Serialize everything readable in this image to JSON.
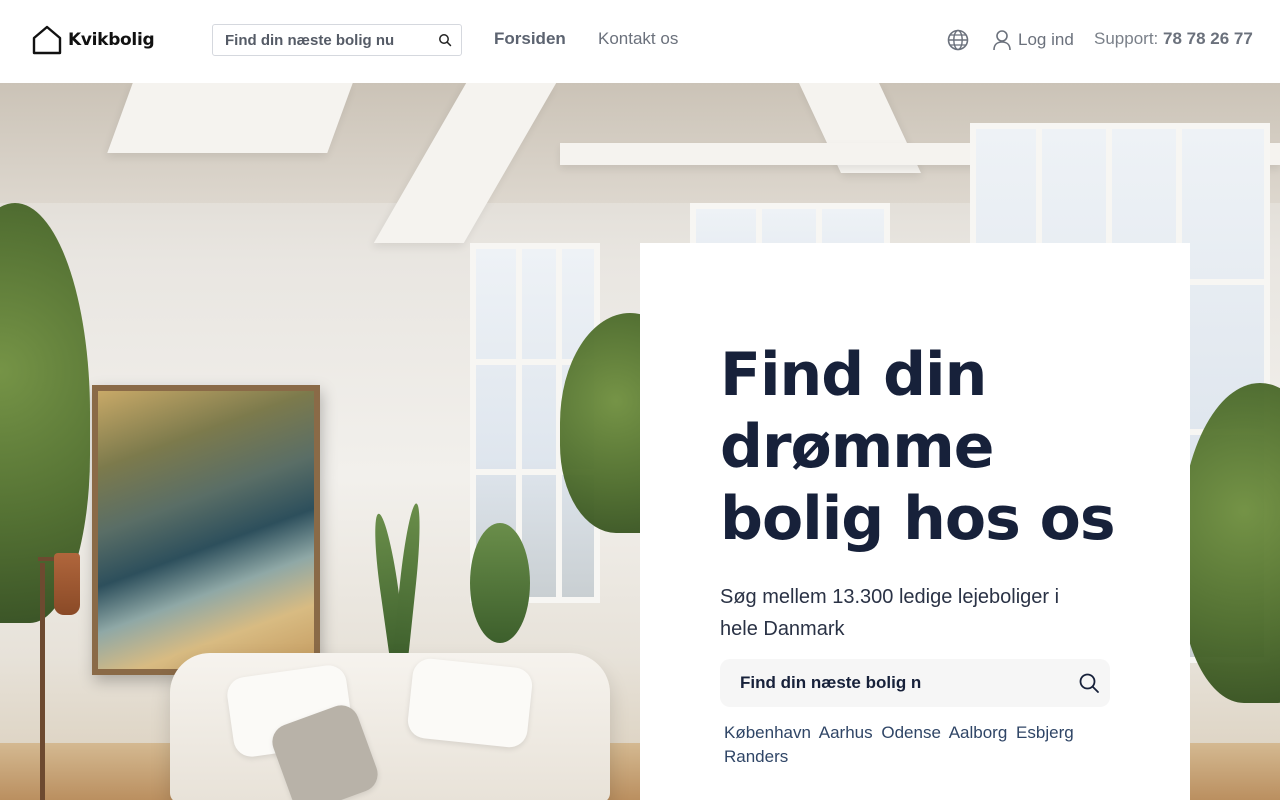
{
  "header": {
    "logo_text": "Kvikbolig",
    "search_placeholder": "Find din næste bolig nu",
    "nav": {
      "home": "Forsiden",
      "contact": "Kontakt os"
    },
    "login_label": "Log ind",
    "support_label": "Support:",
    "support_phone": "78 78 26 77"
  },
  "hero": {
    "title_line1": "Find din",
    "title_line2": "drømme",
    "title_line3": "bolig hos os",
    "subtitle": "Søg mellem 13.300 ledige lejeboliger i hele Danmark",
    "search_placeholder": "Find din næste bolig n",
    "cities": [
      "København",
      "Aarhus",
      "Odense",
      "Aalborg",
      "Esbjerg",
      "Randers"
    ]
  },
  "icons": {
    "logo": "house-outline-icon",
    "header_search": "search-icon",
    "language": "globe-icon",
    "user": "user-icon",
    "card_search": "search-icon"
  },
  "colors": {
    "title": "#17213a",
    "link": "#2f4566",
    "nav_text": "#6b717c"
  }
}
